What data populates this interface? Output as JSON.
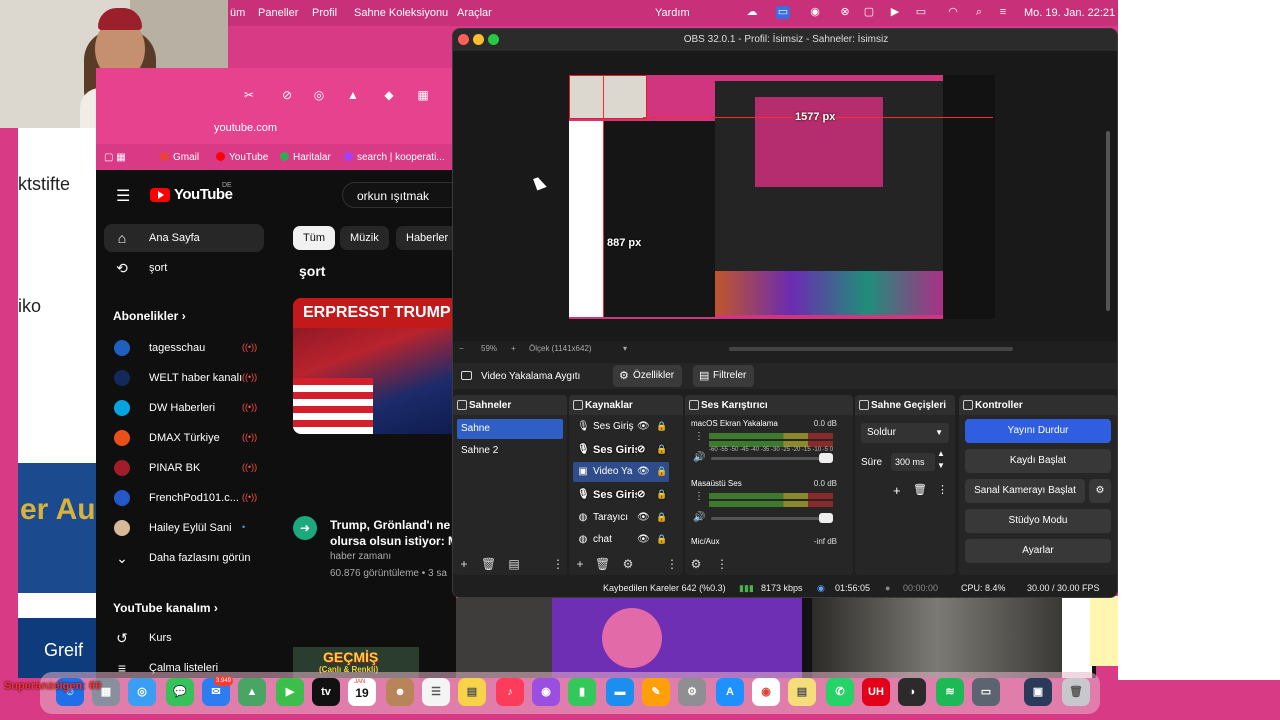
{
  "menubar": {
    "items": [
      "üm",
      "Paneller",
      "Profil",
      "Sahne Koleksiyonu",
      "Araçlar",
      "Yardım"
    ],
    "datetime": "Mo. 19. Jan.  22:21"
  },
  "left_window": {
    "text1": "ktstifte",
    "text2": "iko",
    "text3": "er Au",
    "text4": "Greif"
  },
  "browser": {
    "url": "youtube.com",
    "bookmarks": [
      "Gmail",
      "YouTube",
      "Haritalar",
      "search | kooperati..."
    ],
    "search_value": "orkun ışıtmak",
    "logo": "YouTube",
    "logo_region": "DE",
    "sidebar": {
      "home": "Ana Sayfa",
      "shorts": "şort",
      "subscriptions_title": "Abonelikler",
      "channels": [
        "tagesschau",
        "WELT haber kanalı",
        "DW Haberleri",
        "DMAX Türkiye",
        "PINAR BK",
        "FrenchPod101.c...",
        "Hailey Eylül Sani"
      ],
      "show_more": "Daha fazlasını görün",
      "your_channel": "YouTube kanalım",
      "courses": "Kurs",
      "playlists": "Çalma listeleri"
    },
    "chips": [
      "Tüm",
      "Müzik",
      "Haberler"
    ],
    "shorts_label": "şort",
    "video": {
      "thumb_text": "ERPRESST TRUMP",
      "title_line1": "Trump, Grönland'ı ne p",
      "title_line2": "olursa olsun istiyor: Me",
      "channel": "haber zamanı",
      "meta": "60.876 görüntüleme • 3 sa"
    },
    "thumb2_title": "GEÇMİŞ",
    "thumb2_sub": "(Canlı & Renkli)"
  },
  "obs": {
    "title": "OBS 32.0.1 - Profil: İsimsiz - Sahneler: İsimsiz",
    "width_label": "1577 px",
    "height_label": "887 px",
    "zoom": "59%",
    "scale": "Ölçek (1141x642)",
    "source_name": "Video Yakalama Aygıtı",
    "properties": "Özellikler",
    "filters": "Filtreler",
    "docks": {
      "scenes": "Sahneler",
      "sources": "Kaynaklar",
      "mixer": "Ses Karıştırıcı",
      "transitions": "Sahne Geçişleri",
      "controls": "Kontroller"
    },
    "scenes": [
      "Sahne",
      "Sahne 2"
    ],
    "sources": [
      "Ses Giriş",
      "Ses Giriş",
      "Video Ya",
      "Ses Giriş",
      "Tarayıcı",
      "chat"
    ],
    "mixer": [
      {
        "name": "macOS Ekran Yakalama",
        "db": "0.0 dB"
      },
      {
        "name": "Masaüstü Ses",
        "db": "0.0 dB"
      },
      {
        "name": "Mic/Aux",
        "db": "-inf dB"
      }
    ],
    "meter_ticks": "-60 -55 -50 -45 -40 -35 -30 -25 -20 -15 -10 -5 0",
    "transition": "Soldur",
    "duration_label": "Süre",
    "duration_value": "300 ms",
    "controls": [
      "Yayını Durdur",
      "Kaydı Başlat",
      "Sanal Kamerayı Başlat",
      "Stüdyo Modu",
      "Ayarlar"
    ],
    "status": {
      "dropped": "Kaybedilen Kareler 642 (%0.3)",
      "bitrate": "8173 kbps",
      "stream_time": "01:56:05",
      "rec_time": "00:00:00",
      "cpu": "CPU: 8.4%",
      "fps": "30.00 / 30.00 FPS"
    }
  },
  "dock": {
    "mail_badge": "3.949",
    "cal_month": "JAN",
    "cal_day": "19"
  },
  "ticker": "Superanzeigen: 00"
}
